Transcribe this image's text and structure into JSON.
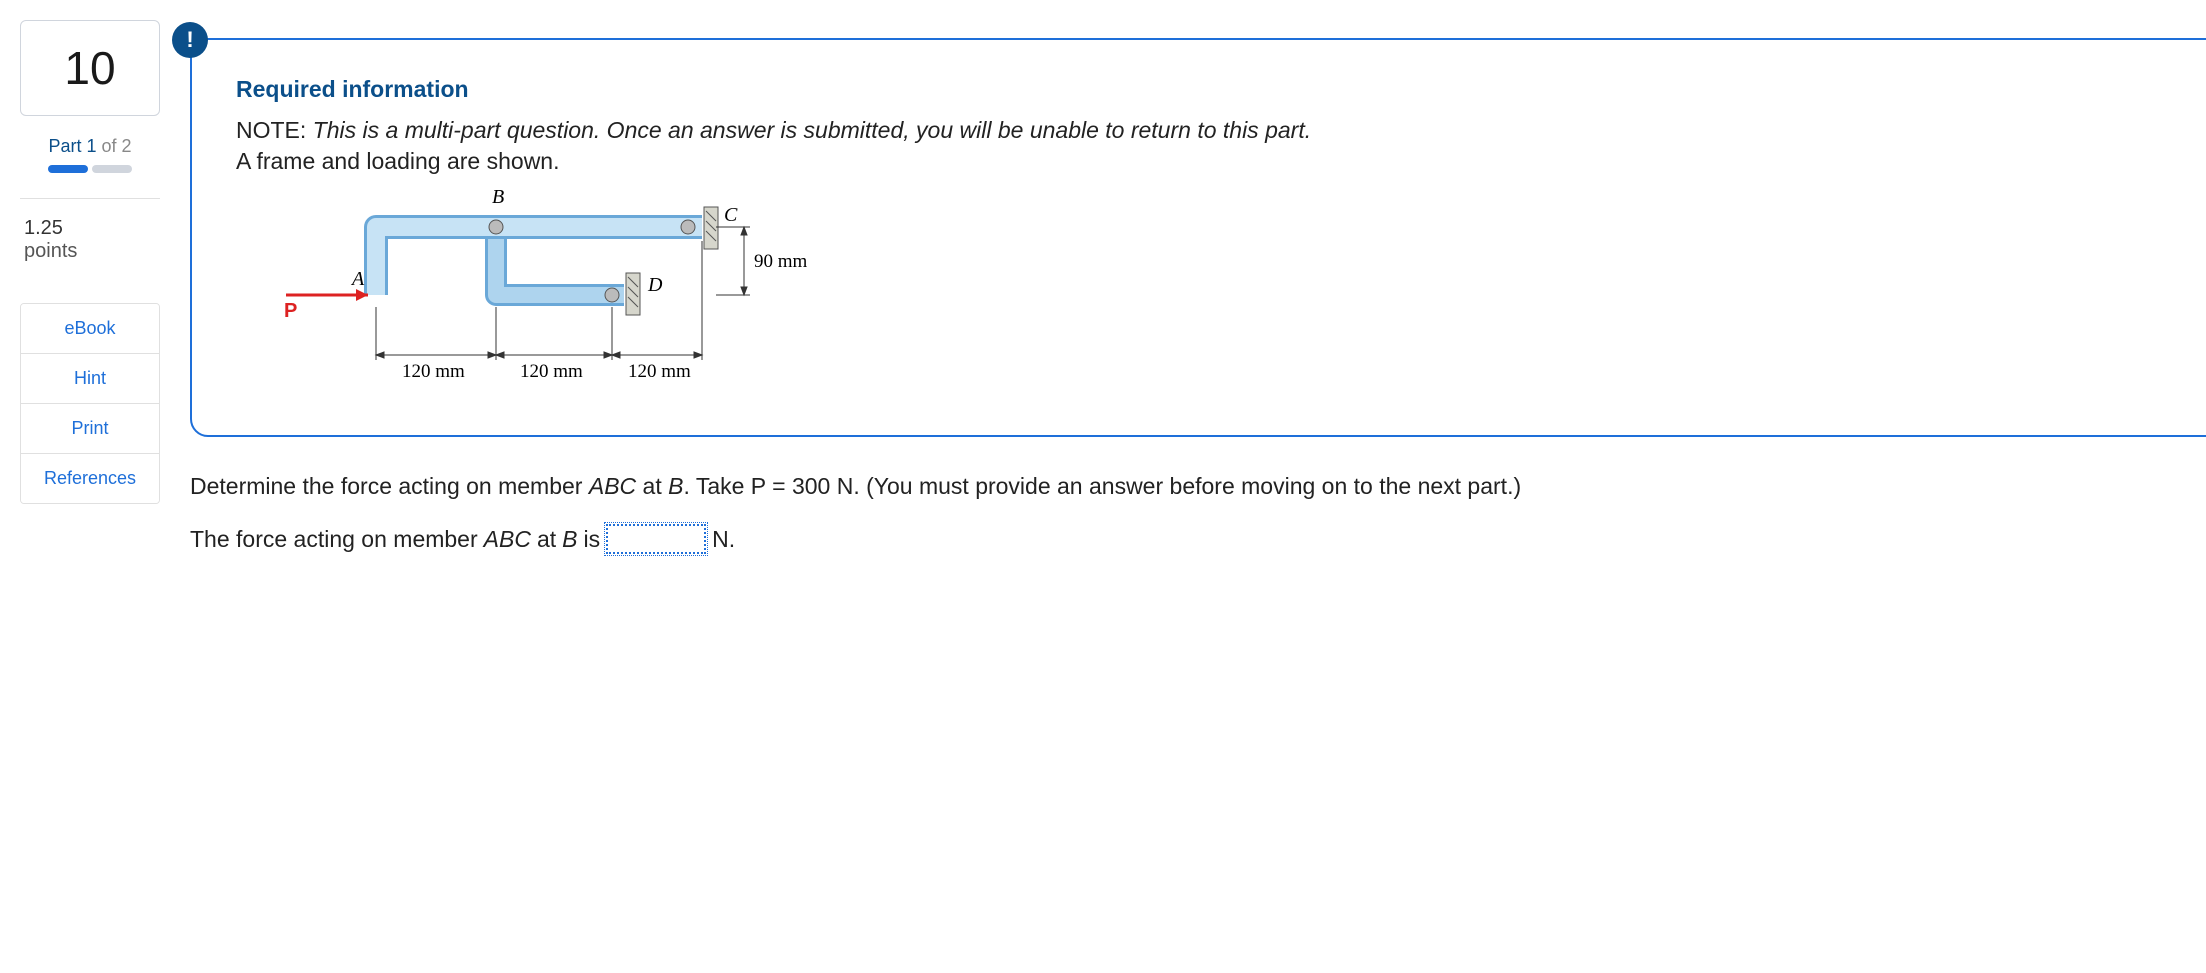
{
  "sidebar": {
    "question_number": "10",
    "part_label_prefix": "Part 1",
    "part_label_suffix": " of 2",
    "points_value": "1.25",
    "points_label": "points",
    "links": [
      "eBook",
      "Hint",
      "Print",
      "References"
    ]
  },
  "alert_icon": "!",
  "required": {
    "heading": "Required information",
    "note_label": "NOTE: ",
    "note_text": "This is a multi-part question. Once an answer is submitted, you will be unable to return to this part.",
    "frame_text": "A frame and loading are shown."
  },
  "diagram": {
    "label_A": "A",
    "label_B": "B",
    "label_C": "C",
    "label_D": "D",
    "label_P": "P",
    "dim1": "120 mm",
    "dim2": "120 mm",
    "dim3": "120 mm",
    "dim_v": "90 mm"
  },
  "question": {
    "prompt_pre": "Determine the force acting on member ",
    "prompt_abc": "ABC",
    "prompt_mid": " at ",
    "prompt_b": "B",
    "prompt_post": ". Take P = 300 N. (You must provide an answer before moving on to the next part.)",
    "answer_pre": "The force acting on member ",
    "answer_abc": "ABC",
    "answer_mid": " at ",
    "answer_b": "B",
    "answer_post": " is",
    "unit": "N.",
    "input_value": ""
  }
}
